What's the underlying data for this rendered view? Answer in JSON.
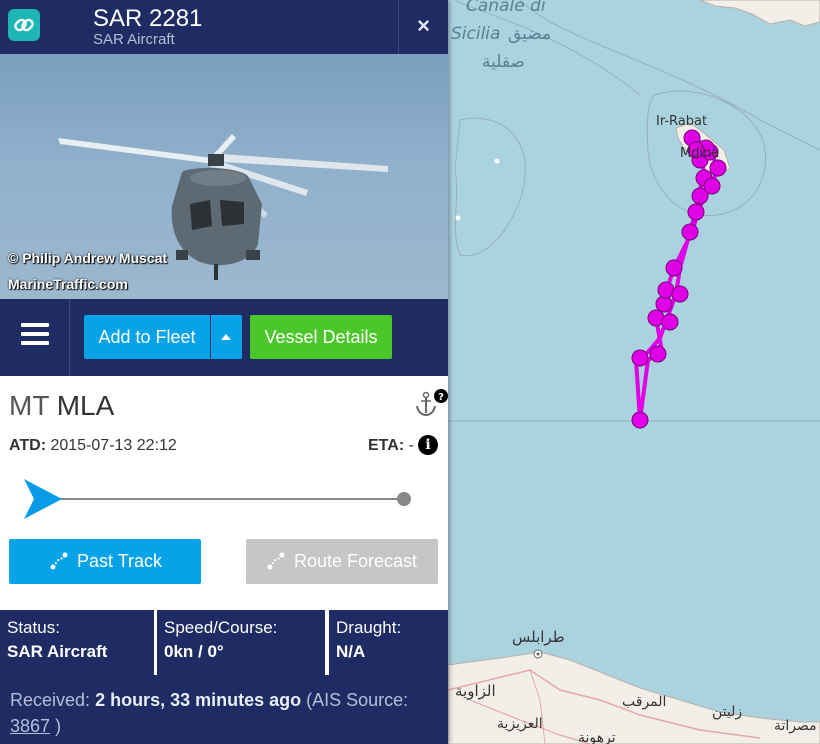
{
  "header": {
    "vessel_name": "SAR 2281",
    "vessel_type": "SAR Aircraft",
    "close_label": "×"
  },
  "photo": {
    "credit_line1": "© Philip Andrew Muscat",
    "credit_line2": "MarineTraffic.com"
  },
  "toolbar": {
    "add_to_fleet_label": "Add to Fleet",
    "vessel_details_label": "Vessel Details"
  },
  "route": {
    "from_code": "MT",
    "port": "MLA",
    "atd_label": "ATD:",
    "atd_value": "2015-07-13 22:12",
    "eta_label": "ETA:",
    "eta_value": "-",
    "progress": 0
  },
  "actions": {
    "past_track_label": "Past Track",
    "route_forecast_label": "Route Forecast"
  },
  "stats": {
    "status_label": "Status:",
    "status_value": "SAR Aircraft",
    "speed_label": "Speed/Course:",
    "speed_value": "0kn / 0°",
    "draught_label": "Draught:",
    "draught_value": "N/A"
  },
  "footer": {
    "received_label": "Received:",
    "received_value": "2 hours, 33 minutes ago",
    "source_prefix": "(AIS Source:",
    "source_id": "3867",
    "source_suffix": ")"
  },
  "map": {
    "labels": {
      "canale": "Canale di",
      "sicilia": "Sicilia",
      "sicilia_ar1": "مضيق",
      "sicilia_ar2": "صقلية",
      "ir_rabat": "Ir-Rabat",
      "mdina": "Mdina",
      "tripoli": "طرابلس",
      "zawiya": "الزاوية",
      "azizia": "العزيزية",
      "tarhuna": "ترهونة",
      "marqab": "المرقب",
      "zliten": "زليتن",
      "misrata": "مصراتة"
    },
    "colors": {
      "sea": "#aad3df",
      "land": "#f2efe9",
      "track": "#e000e6"
    }
  }
}
